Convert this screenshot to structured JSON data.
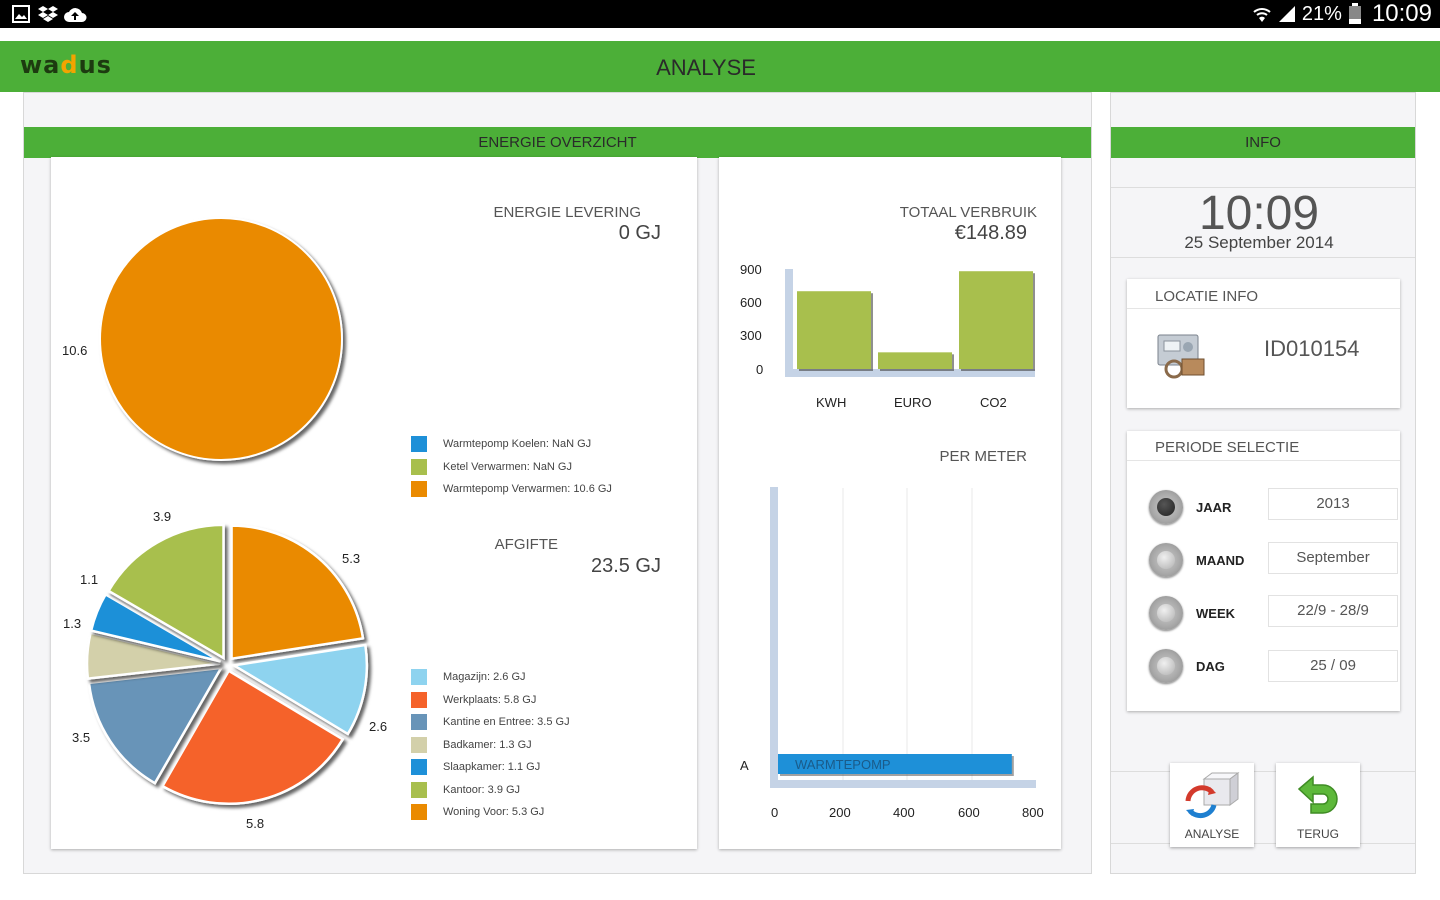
{
  "status_bar": {
    "battery": "21%",
    "time": "10:09"
  },
  "app": {
    "logo": "wadus",
    "title": "ANALYSE"
  },
  "energie_overzicht": {
    "header": "ENERGIE OVERZICHT",
    "levering": {
      "title": "ENERGIE LEVERING",
      "value": "0 GJ",
      "pie_labels": [
        "10.6"
      ],
      "legend": [
        {
          "label": "Warmtepomp Koelen: NaN GJ",
          "color": "#1e90d8"
        },
        {
          "label": "Ketel Verwarmen: NaN GJ",
          "color": "#a8bf4d"
        },
        {
          "label": "Warmtepomp Verwarmen: 10.6 GJ",
          "color": "#ea8a00"
        }
      ]
    },
    "afgifte": {
      "title": "AFGIFTE",
      "value": "23.5 GJ",
      "pie_labels": [
        "5.3",
        "2.6",
        "5.8",
        "3.5",
        "1.3",
        "1.1",
        "3.9"
      ],
      "legend": [
        {
          "label": "Magazijn: 2.6 GJ",
          "color": "#8ed3ef"
        },
        {
          "label": "Werkplaats: 5.8 GJ",
          "color": "#f5622a"
        },
        {
          "label": "Kantine en Entree: 3.5 GJ",
          "color": "#6894b8"
        },
        {
          "label": "Badkamer: 1.3 GJ",
          "color": "#d3d0aa"
        },
        {
          "label": "Slaapkamer: 1.1 GJ",
          "color": "#1e90d8"
        },
        {
          "label": "Kantoor: 3.9 GJ",
          "color": "#a8bf4d"
        },
        {
          "label": "Woning Voor: 5.3 GJ",
          "color": "#ea8a00"
        }
      ]
    },
    "totaal": {
      "title": "TOTAAL VERBRUIK",
      "value": "€148.89",
      "y_ticks": [
        "900",
        "600",
        "300",
        "0"
      ],
      "categories": [
        "KWH",
        "EURO",
        "CO2"
      ]
    },
    "per_meter": {
      "title": "PER METER",
      "bar_label": "WARMTEPOMP",
      "category": "A",
      "x_ticks": [
        "0",
        "200",
        "400",
        "600",
        "800"
      ]
    }
  },
  "chart_data": [
    {
      "type": "pie",
      "title": "ENERGIE LEVERING",
      "labels": [
        "Warmtepomp Koelen",
        "Ketel Verwarmen",
        "Warmtepomp Verwarmen"
      ],
      "values": [
        0,
        0,
        10.6
      ],
      "colors": [
        "#1e90d8",
        "#a8bf4d",
        "#ea8a00"
      ]
    },
    {
      "type": "pie",
      "title": "AFGIFTE",
      "labels": [
        "Woning Voor",
        "Magazijn",
        "Werkplaats",
        "Kantine en Entree",
        "Badkamer",
        "Slaapkamer",
        "Kantoor"
      ],
      "values": [
        5.3,
        2.6,
        5.8,
        3.5,
        1.3,
        1.1,
        3.9
      ],
      "colors": [
        "#ea8a00",
        "#8ed3ef",
        "#f5622a",
        "#6894b8",
        "#d3d0aa",
        "#1e90d8",
        "#a8bf4d"
      ]
    },
    {
      "type": "bar",
      "title": "TOTAAL VERBRUIK",
      "categories": [
        "KWH",
        "EURO",
        "CO2"
      ],
      "values": [
        700,
        150,
        880
      ],
      "ylim": [
        0,
        900
      ],
      "color": "#a8bf4d"
    },
    {
      "type": "bar",
      "orientation": "horizontal",
      "title": "PER METER",
      "categories": [
        "A"
      ],
      "series": [
        {
          "name": "WARMTEPOMP",
          "values": [
            725
          ]
        }
      ],
      "xlim": [
        0,
        800
      ],
      "color": "#1e90d8"
    }
  ],
  "info": {
    "header": "INFO",
    "clock": "10:09",
    "date": "25 September 2014",
    "locatie": {
      "title": "LOCATIE INFO",
      "id": "ID010154"
    },
    "periode": {
      "title": "PERIODE SELECTIE",
      "options": [
        {
          "label": "JAAR",
          "value": "2013",
          "selected": true
        },
        {
          "label": "MAAND",
          "value": "September",
          "selected": false
        },
        {
          "label": "WEEK",
          "value": "22/9 - 28/9",
          "selected": false
        },
        {
          "label": "DAG",
          "value": "25 / 09",
          "selected": false
        }
      ]
    },
    "buttons": {
      "analyse": "ANALYSE",
      "terug": "TERUG"
    }
  }
}
